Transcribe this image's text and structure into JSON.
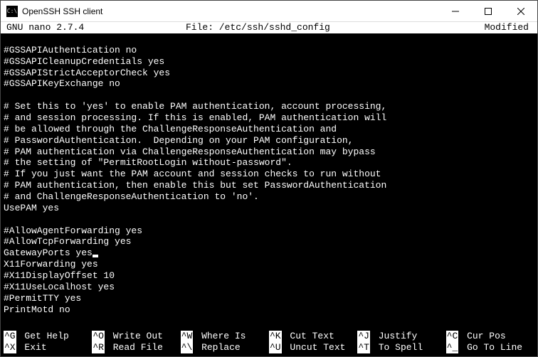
{
  "window": {
    "title": "OpenSSH SSH client",
    "icon_text": "C:\\"
  },
  "nano": {
    "version": "GNU nano 2.7.4",
    "file_label": "File: /etc/ssh/sshd_config",
    "status": "Modified"
  },
  "lines": [
    "",
    "#GSSAPIAuthentication no",
    "#GSSAPICleanupCredentials yes",
    "#GSSAPIStrictAcceptorCheck yes",
    "#GSSAPIKeyExchange no",
    "",
    "# Set this to 'yes' to enable PAM authentication, account processing,",
    "# and session processing. If this is enabled, PAM authentication will",
    "# be allowed through the ChallengeResponseAuthentication and",
    "# PasswordAuthentication.  Depending on your PAM configuration,",
    "# PAM authentication via ChallengeResponseAuthentication may bypass",
    "# the setting of \"PermitRootLogin without-password\".",
    "# If you just want the PAM account and session checks to run without",
    "# PAM authentication, then enable this but set PasswordAuthentication",
    "# and ChallengeResponseAuthentication to 'no'.",
    "UsePAM yes",
    "",
    "#AllowAgentForwarding yes",
    "#AllowTcpForwarding yes",
    "GatewayPorts yes",
    "X11Forwarding yes",
    "#X11DisplayOffset 10",
    "#X11UseLocalhost yes",
    "#PermitTTY yes",
    "PrintMotd no"
  ],
  "cursor_line": 19,
  "shortcuts": [
    {
      "key": "^G",
      "label": "Get Help"
    },
    {
      "key": "^O",
      "label": "Write Out"
    },
    {
      "key": "^W",
      "label": "Where Is"
    },
    {
      "key": "^K",
      "label": "Cut Text"
    },
    {
      "key": "^J",
      "label": "Justify"
    },
    {
      "key": "^C",
      "label": "Cur Pos"
    },
    {
      "key": "^X",
      "label": "Exit"
    },
    {
      "key": "^R",
      "label": "Read File"
    },
    {
      "key": "^\\",
      "label": "Replace"
    },
    {
      "key": "^U",
      "label": "Uncut Text"
    },
    {
      "key": "^T",
      "label": "To Spell"
    },
    {
      "key": "^_",
      "label": "Go To Line"
    }
  ]
}
